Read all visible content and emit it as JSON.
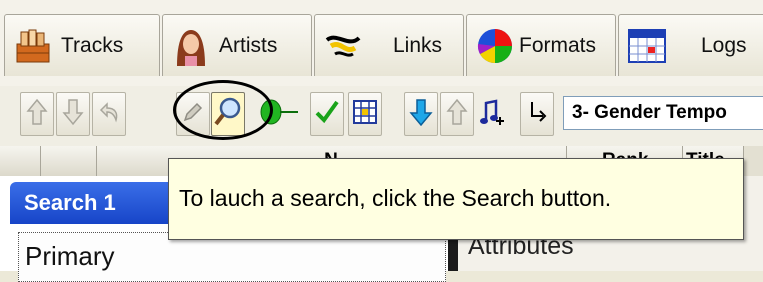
{
  "tabs": [
    {
      "label": "Tracks",
      "icon": "crate-icon"
    },
    {
      "label": "Artists",
      "icon": "artist-portrait-icon"
    },
    {
      "label": "Links",
      "icon": "link-scribble-icon"
    },
    {
      "label": "Formats",
      "icon": "pie-chart-icon"
    },
    {
      "label": "Logs",
      "icon": "calendar-grid-icon"
    }
  ],
  "toolbar": {
    "preset_value": "3- Gender Tempo"
  },
  "grid_header": {
    "name_col": "N",
    "rank_col": "Rank",
    "title_col": "Title"
  },
  "search_panel": {
    "title": "Search 1",
    "primary_label": "Primary",
    "attributes_label": "Attributes"
  },
  "tooltip": {
    "text": "To lauch a search, click the Search button."
  },
  "colors": {
    "tooltip_bg": "#ffffe1",
    "search_header": "#1745c8",
    "accent_green": "#1aa31a"
  }
}
